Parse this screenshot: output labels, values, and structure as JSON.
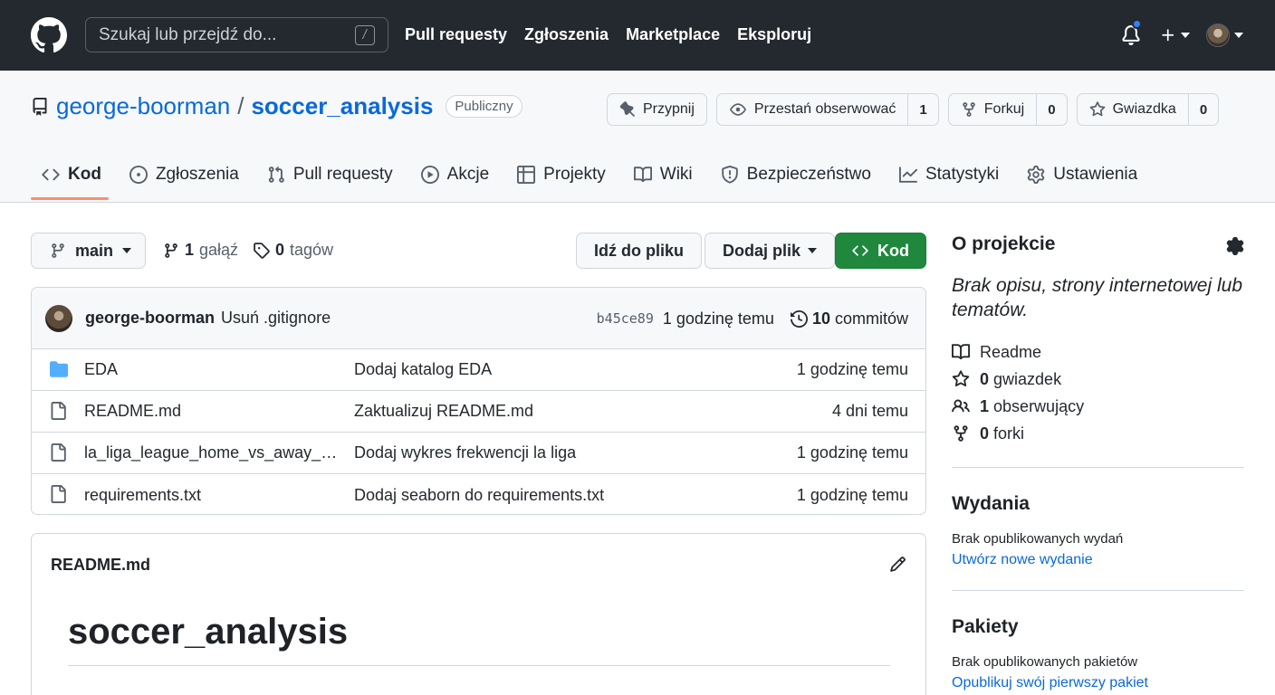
{
  "header": {
    "search_placeholder": "Szukaj lub przejdź do...",
    "search_shortcut": "/",
    "nav": [
      "Pull requesty",
      "Zgłoszenia",
      "Marketplace",
      "Eksploruj"
    ]
  },
  "repo": {
    "owner": "george-boorman",
    "separator": "/",
    "name": "soccer_analysis",
    "visibility": "Publiczny",
    "actions": {
      "pin_label": "Przypnij",
      "watch_label": "Przestań obserwować",
      "watch_count": "1",
      "fork_label": "Forkuj",
      "fork_count": "0",
      "star_label": "Gwiazdka",
      "star_count": "0"
    },
    "tabs": [
      {
        "label": "Kod",
        "icon": "code-icon"
      },
      {
        "label": "Zgłoszenia",
        "icon": "issue-icon"
      },
      {
        "label": "Pull requesty",
        "icon": "pull-request-icon"
      },
      {
        "label": "Akcje",
        "icon": "play-icon"
      },
      {
        "label": "Projekty",
        "icon": "table-icon"
      },
      {
        "label": "Wiki",
        "icon": "book-icon"
      },
      {
        "label": "Bezpieczeństwo",
        "icon": "shield-icon"
      },
      {
        "label": "Statystyki",
        "icon": "graph-icon"
      },
      {
        "label": "Ustawienia",
        "icon": "gear-icon"
      }
    ]
  },
  "toolbar": {
    "branch": "main",
    "branch_count": "1",
    "branch_label": "gałąź",
    "tag_count": "0",
    "tag_label": "tagów",
    "goto_file": "Idź do pliku",
    "add_file": "Dodaj plik",
    "code": "Kod"
  },
  "commit": {
    "author": "george-boorman",
    "message": "Usuń .gitignore",
    "sha": "b45ce89",
    "time": "1 godzinę temu",
    "count": "10",
    "count_label": "commitów"
  },
  "files": [
    {
      "type": "folder",
      "name": "EDA",
      "message": "Dodaj katalog EDA",
      "time": "1 godzinę temu"
    },
    {
      "type": "file",
      "name": "README.md",
      "message": "Zaktualizuj README.md",
      "time": "4 dni temu"
    },
    {
      "type": "file",
      "name": "la_liga_league_home_vs_away_att...",
      "message": "Dodaj wykres frekwencji la liga",
      "time": "1 godzinę temu"
    },
    {
      "type": "file",
      "name": "requirements.txt",
      "message": "Dodaj seaborn do requirements.txt",
      "time": "1 godzinę temu"
    }
  ],
  "readme": {
    "filename": "README.md",
    "heading": "soccer_analysis"
  },
  "sidebar": {
    "about_title": "O projekcie",
    "about_desc": "Brak opisu, strony internetowej lub tematów.",
    "readme_label": "Readme",
    "stars_count": "0",
    "stars_label": "gwiazdek",
    "watchers_count": "1",
    "watchers_label": "obserwujący",
    "forks_count": "0",
    "forks_label": "forki",
    "releases_title": "Wydania",
    "releases_empty": "Brak opublikowanych wydań",
    "releases_link": "Utwórz nowe wydanie",
    "packages_title": "Pakiety",
    "packages_empty": "Brak opublikowanych pakietów",
    "packages_link": "Opublikuj swój pierwszy pakiet"
  },
  "colors": {
    "header_bg": "#24292f",
    "link": "#0969da",
    "primary_button": "#1f883d",
    "tab_underline": "#fd8c73",
    "notification_dot": "#2f81f7"
  }
}
